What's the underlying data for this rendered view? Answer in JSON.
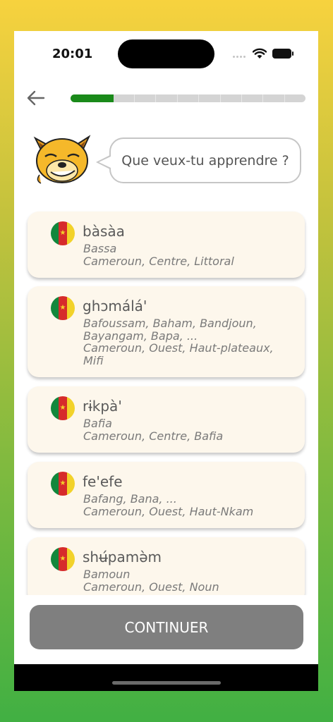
{
  "status": {
    "time": "20:01"
  },
  "progress": {
    "segments": 11,
    "completed": 2,
    "fraction": 0.18
  },
  "prompt": {
    "text": "Que veux-tu apprendre ?"
  },
  "colors": {
    "progress": "#1a8a1a",
    "button": "#7f7f7f",
    "card": "#fdf7ec",
    "flag_green": "#12873c",
    "flag_red": "#d62b2b",
    "flag_yellow": "#f2d22a"
  },
  "languages": [
    {
      "name": "bàsàa",
      "lines": [
        "Bassa",
        "Cameroun, Centre, Littoral"
      ],
      "flag": "cameroon-flag-icon"
    },
    {
      "name": "ghɔmálá'",
      "lines": [
        "Bafoussam, Baham, Bandjoun,",
        "Bayangam, Bapa, ...",
        "Cameroun, Ouest, Haut-plateaux,",
        "Mifi"
      ],
      "flag": "cameroon-flag-icon"
    },
    {
      "name": "rɨkpà'",
      "lines": [
        "Bafia",
        "Cameroun, Centre, Bafia"
      ],
      "flag": "cameroon-flag-icon"
    },
    {
      "name": "fe'efe",
      "lines": [
        "Bafang, Bana, ...",
        "Cameroun, Ouest, Haut-Nkam"
      ],
      "flag": "cameroon-flag-icon"
    },
    {
      "name": "shʉ́pamə̀m",
      "lines": [
        "Bamoun",
        "Cameroun, Ouest, Noun"
      ],
      "flag": "cameroon-flag-icon"
    }
  ],
  "button": {
    "label": "CONTINUER"
  }
}
